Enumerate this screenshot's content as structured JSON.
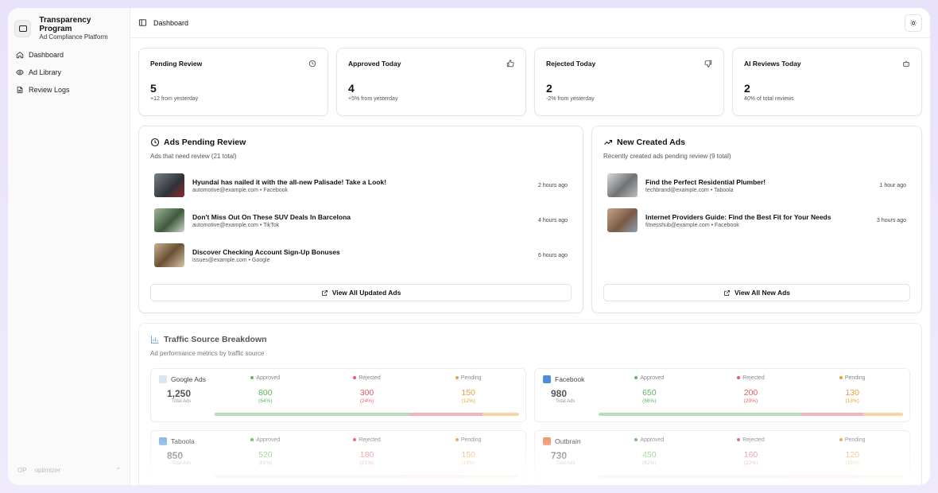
{
  "brand": {
    "title": "Transparency Program",
    "subtitle": "Ad Compliance Platform"
  },
  "nav": [
    {
      "label": "Dashboard",
      "icon": "home-icon"
    },
    {
      "label": "Ad Library",
      "icon": "eye-icon"
    },
    {
      "label": "Review Logs",
      "icon": "file-text-icon"
    }
  ],
  "user": {
    "initials": "OP",
    "name": "optimizer"
  },
  "topbar": {
    "title": "Dashboard"
  },
  "stats": [
    {
      "label": "Pending Review",
      "value": "5",
      "sub": "+12 from yesterday",
      "icon": "clock-icon"
    },
    {
      "label": "Approved Today",
      "value": "4",
      "sub": "+5% from yesterday",
      "icon": "thumbs-up-icon"
    },
    {
      "label": "Rejected Today",
      "value": "2",
      "sub": "-2% from yesterday",
      "icon": "thumbs-down-icon"
    },
    {
      "label": "AI Reviews Today",
      "value": "2",
      "sub": "40% of total reviews",
      "icon": "bot-icon"
    }
  ],
  "pending": {
    "title": "Ads Pending Review",
    "subtitle": "Ads that need review (21 total)",
    "items": [
      {
        "title": "Hyundai has nailed it with the all-new Palisade! Take a Look!",
        "meta": "automotive@example.com • Facebook",
        "time": "2 hours ago",
        "color": "#4a4f55"
      },
      {
        "title": "Don't Miss Out On These SUV Deals In Barcelona",
        "meta": "automotive@example.com • TikTok",
        "time": "4 hours ago",
        "color": "#4f6a4b"
      },
      {
        "title": "Discover Checking Account Sign-Up Bonuses",
        "meta": "issues@example.com • Google",
        "time": "6 hours ago",
        "color": "#8a7055"
      }
    ],
    "button": "View All Updated Ads"
  },
  "newads": {
    "title": "New Created Ads",
    "subtitle": "Recently created ads pending review (9 total)",
    "items": [
      {
        "title": "Find the Perfect Residential Plumber!",
        "meta": "techbrand@example.com • Taboola",
        "time": "1 hour ago",
        "color": "#7c7e80"
      },
      {
        "title": "Internet Providers Guide: Find the Best Fit for Your Needs",
        "meta": "fitnesshub@example.com • Facebook",
        "time": "3 hours ago",
        "color": "#8a6d55"
      }
    ],
    "button": "View All New Ads"
  },
  "traffic": {
    "title": "Traffic Source Breakdown",
    "subtitle": "Ad performance metrics by traffic source",
    "total_label": "Total Ads",
    "labels": {
      "approved": "Approved",
      "rejected": "Rejected",
      "pending": "Pending"
    },
    "colors": {
      "approved": "#5cb85c",
      "rejected": "#e65b66",
      "pending": "#e8a13a"
    },
    "sources": [
      {
        "name": "Google Ads",
        "badge": "#dbe6f4",
        "total": "1,250",
        "approved": "800",
        "approved_pct": "(64%)",
        "rejected": "300",
        "rejected_pct": "(24%)",
        "pending": "150",
        "pending_pct": "(12%)",
        "share": [
          64,
          24,
          12
        ]
      },
      {
        "name": "Facebook",
        "badge": "#4f8edb",
        "total": "980",
        "approved": "650",
        "approved_pct": "(66%)",
        "rejected": "200",
        "rejected_pct": "(20%)",
        "pending": "130",
        "pending_pct": "(13%)",
        "share": [
          66,
          20,
          13
        ]
      },
      {
        "name": "Taboola",
        "badge": "#7fb2e6",
        "total": "850",
        "approved": "520",
        "approved_pct": "(61%)",
        "rejected": "180",
        "rejected_pct": "(21%)",
        "pending": "150",
        "pending_pct": "(18%)",
        "share": [
          61,
          21,
          18
        ]
      },
      {
        "name": "Outbrain",
        "badge": "#f08a5d",
        "total": "730",
        "approved": "450",
        "approved_pct": "(62%)",
        "rejected": "160",
        "rejected_pct": "(22%)",
        "pending": "120",
        "pending_pct": "(16%)",
        "share": [
          62,
          22,
          16
        ]
      }
    ]
  }
}
